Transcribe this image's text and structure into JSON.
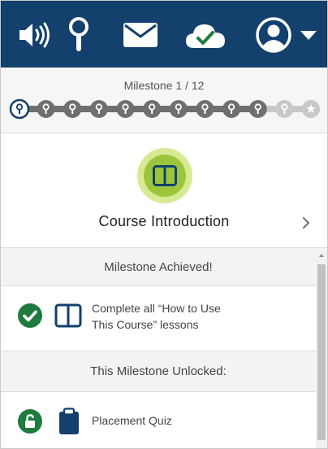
{
  "topbar": {
    "icons": [
      "speaker-icon",
      "pin-icon",
      "mail-icon",
      "cloud-check-icon",
      "user-icon",
      "caret-down-icon"
    ],
    "colors": {
      "background": "#13406d",
      "icon": "#ffffff",
      "check": "#1f7a3e"
    }
  },
  "milestone": {
    "label": "Milestone 1 / 12",
    "current": 1,
    "total": 12
  },
  "course": {
    "icon": "book-icon",
    "title": "Course Introduction",
    "chevron": "chevron-right-icon"
  },
  "achieved": {
    "header": "Milestone Achieved!",
    "items": [
      {
        "status_icon": "check-circle-icon",
        "type_icon": "book-outline-icon",
        "line1": "Complete all “How to Use",
        "line2": "This Course” lessons"
      }
    ]
  },
  "unlocked": {
    "header": "This Milestone Unlocked:",
    "items": [
      {
        "status_icon": "unlock-icon",
        "type_icon": "clipboard-icon",
        "label": "Placement Quiz"
      }
    ]
  },
  "colors": {
    "green": "#1f7a3e",
    "navy": "#13406d",
    "dark_node": "#6f6f6f",
    "light_node": "#c8c8c8"
  }
}
